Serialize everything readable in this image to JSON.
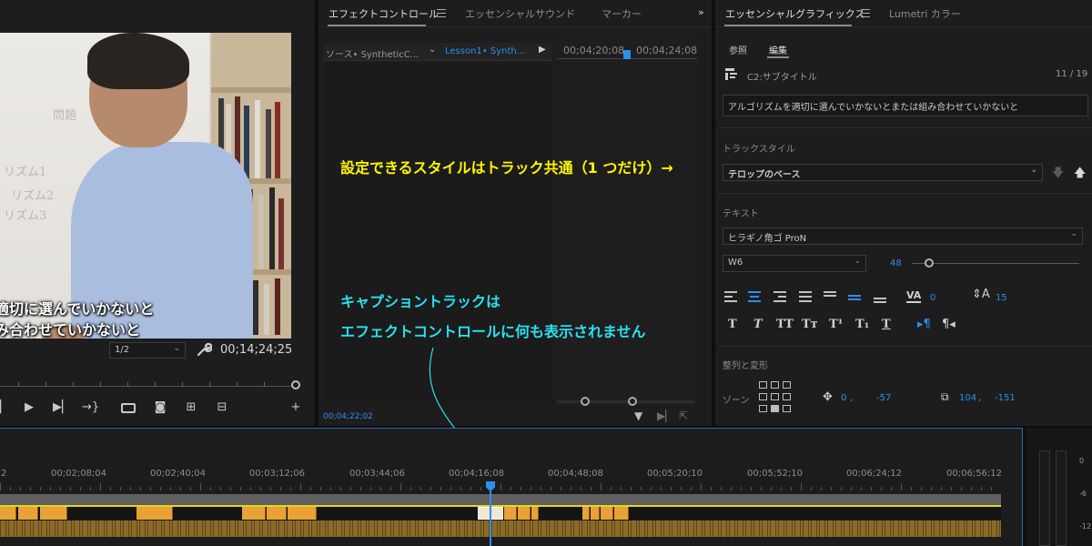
{
  "monitor": {
    "video_captions": [
      "適切に選んでいかないと",
      "み合わせていかないと"
    ],
    "board_sketch": [
      "リズム1",
      "リズム2",
      "リズム3",
      "問題"
    ],
    "resolution": "1/2",
    "timecode": "00;14;24;25"
  },
  "effect_controls": {
    "tabs": [
      "エフェクトコントロール",
      "エッセンシャルサウンド",
      "マーカー"
    ],
    "source_label": "ソース• SyntheticC...",
    "sequence_label": "Lesson1• Synth...",
    "tc_start": "00;04;20;08",
    "tc_end": "00;04;24;08",
    "bottom_tc": "00;04;22;02"
  },
  "essential_graphics": {
    "tabs": [
      "エッセンシャルグラフィックス",
      "Lumetri カラー"
    ],
    "subtabs": [
      "参照",
      "編集"
    ],
    "clip_name": "C2:サブタイトル",
    "clip_count": "11 / 19",
    "caption_text": "アルゴリズムを適切に選んでいかないとまたは組み合わせていかないと",
    "track_style_label": "トラックスタイル",
    "track_style_value": "テロップのベース",
    "text_label": "テキスト",
    "font_family": "ヒラギノ角ゴ ProN",
    "font_weight": "W6",
    "font_size": "48",
    "font_size_fraction": 0.08,
    "kerning": "0",
    "leading": "15",
    "format_buttons": [
      "T",
      "T",
      "TT",
      "Tт",
      "T¹",
      "T₁",
      "T"
    ],
    "align_label": "整列と変形",
    "zone_label": "ゾーン",
    "position": {
      "x": "0",
      "y": "-57"
    },
    "size": {
      "w": "104",
      "h": "-151"
    }
  },
  "annotations": {
    "yellow": "設定できるスタイルはトラック共通（1 つだけ）→",
    "cyan_line1": "キャプショントラックは",
    "cyan_line2": "エフェクトコントロールに何も表示されません"
  },
  "timeline": {
    "timecodes": [
      "2",
      "00;02;08;04",
      "00;02;40;04",
      "00;03;12;06",
      "00;03;44;06",
      "00;04;16;08",
      "00;04;48;08",
      "00;05;20;10",
      "00;05;52;10",
      "00;06;24;12",
      "00;06;56;12"
    ]
  },
  "meter": {
    "db_labels": [
      "0",
      "-6",
      "-12"
    ]
  },
  "colors": {
    "accent_blue": "#2e8ef0",
    "caption_orange": "#e8a236",
    "annotation_yellow": "#fff700",
    "annotation_cyan": "#2ae0f0"
  }
}
